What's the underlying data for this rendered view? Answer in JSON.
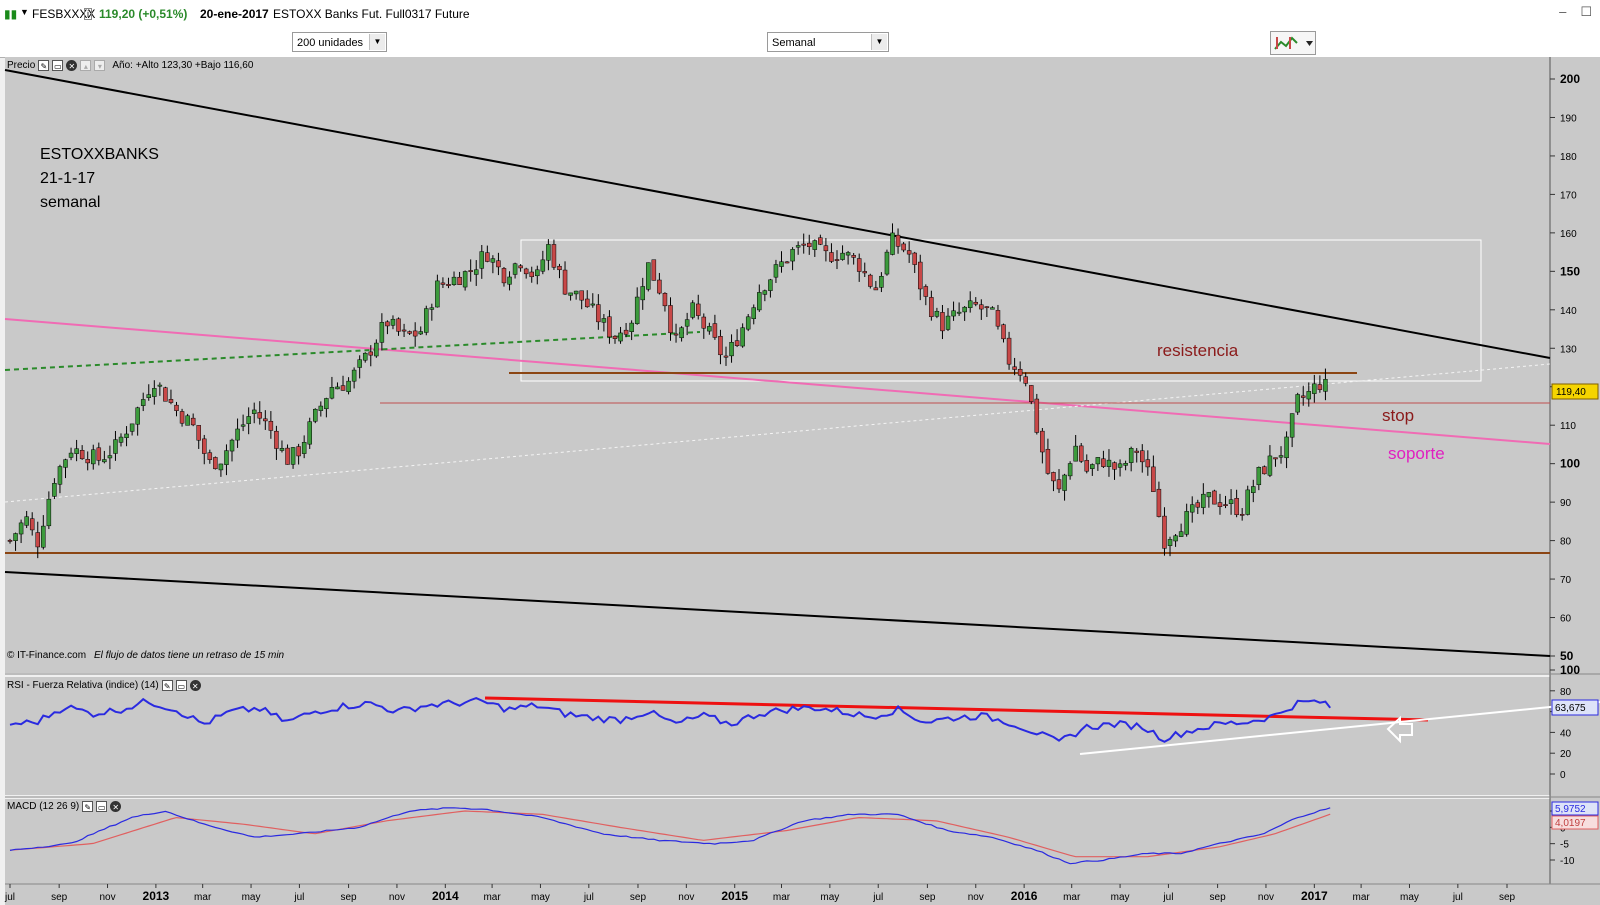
{
  "window": {
    "symbol": "FESBXXXX",
    "price_change": "119,20 (+0,51%)",
    "date": "20-ene-2017",
    "instrument": "ESTOXX Banks Fut. Full0317 Future"
  },
  "toolbar": {
    "units_select": "200 unidades",
    "period_select": "Semanal"
  },
  "price_panel": {
    "label": "Precio",
    "stats": "Año: +Alto 123,30 +Bajo 116,60",
    "last_price": "119,40",
    "footer": "© IT-Finance.com",
    "footer_note": "El flujo de datos tiene un retraso de 15 min",
    "annotation_lines": [
      "ESTOXXBANKS",
      "21-1-17",
      "semanal"
    ],
    "label_resistencia": "resistencia",
    "label_stop": "stop",
    "label_soporte": "soporte"
  },
  "rsi_panel": {
    "label": "RSI - Fuerza Relativa (indice) (14)",
    "last_value": "63,675"
  },
  "macd_panel": {
    "label": "MACD (12 26 9)",
    "last_macd": "5,9752",
    "last_signal": "4,0197"
  },
  "x_axis_labels": [
    {
      "label": "jul",
      "major": false
    },
    {
      "label": "sep",
      "major": false
    },
    {
      "label": "nov",
      "major": false
    },
    {
      "label": "2013",
      "major": true
    },
    {
      "label": "mar",
      "major": false
    },
    {
      "label": "may",
      "major": false
    },
    {
      "label": "jul",
      "major": false
    },
    {
      "label": "sep",
      "major": false
    },
    {
      "label": "nov",
      "major": false
    },
    {
      "label": "2014",
      "major": true
    },
    {
      "label": "mar",
      "major": false
    },
    {
      "label": "may",
      "major": false
    },
    {
      "label": "jul",
      "major": false
    },
    {
      "label": "sep",
      "major": false
    },
    {
      "label": "nov",
      "major": false
    },
    {
      "label": "2015",
      "major": true
    },
    {
      "label": "mar",
      "major": false
    },
    {
      "label": "may",
      "major": false
    },
    {
      "label": "jul",
      "major": false
    },
    {
      "label": "sep",
      "major": false
    },
    {
      "label": "nov",
      "major": false
    },
    {
      "label": "2016",
      "major": true
    },
    {
      "label": "mar",
      "major": false
    },
    {
      "label": "may",
      "major": false
    },
    {
      "label": "jul",
      "major": false
    },
    {
      "label": "sep",
      "major": false
    },
    {
      "label": "nov",
      "major": false
    },
    {
      "label": "2017",
      "major": true
    },
    {
      "label": "mar",
      "major": false
    },
    {
      "label": "may",
      "major": false
    },
    {
      "label": "jul",
      "major": false
    },
    {
      "label": "sep",
      "major": false
    }
  ],
  "chart_data": [
    {
      "type": "line",
      "title": "ESTOXXBANKS",
      "subtitle": "21-1-17 semanal",
      "x_range": [
        "2012-07-01",
        "2017-09-30"
      ],
      "ylim": [
        50,
        205
      ],
      "y_ticks": [
        200,
        190,
        180,
        170,
        160,
        150,
        140,
        130,
        120,
        110,
        100,
        90,
        80,
        70,
        60,
        50
      ],
      "y_tick_labels": [
        "200",
        "190",
        "180",
        "170",
        "160",
        "150",
        "140",
        "130",
        "",
        "110",
        "100",
        "90",
        "80",
        "70",
        "60",
        "50"
      ],
      "grid": false,
      "series": [
        {
          "values": [
            [
              "2012-07-01",
              80
            ],
            [
              "2012-07-21",
              86
            ],
            [
              "2012-08-04",
              79
            ],
            [
              "2012-08-25",
              96
            ],
            [
              "2012-09-15",
              104
            ],
            [
              "2012-09-29",
              103
            ],
            [
              "2012-10-20",
              101
            ],
            [
              "2012-11-10",
              104
            ],
            [
              "2012-12-01",
              111
            ],
            [
              "2012-12-29",
              122
            ],
            [
              "2013-01-26",
              114
            ],
            [
              "2013-02-16",
              110
            ],
            [
              "2013-03-09",
              100
            ],
            [
              "2013-03-23",
              101
            ],
            [
              "2013-04-13",
              108
            ],
            [
              "2013-05-04",
              114
            ],
            [
              "2013-05-25",
              109
            ],
            [
              "2013-06-15",
              101
            ],
            [
              "2013-06-29",
              103
            ],
            [
              "2013-07-20",
              112
            ],
            [
              "2013-08-10",
              120
            ],
            [
              "2013-08-31",
              121
            ],
            [
              "2013-09-21",
              127
            ],
            [
              "2013-10-19",
              137
            ],
            [
              "2013-11-09",
              133
            ],
            [
              "2013-11-30",
              134
            ],
            [
              "2013-12-21",
              146
            ],
            [
              "2014-01-11",
              148
            ],
            [
              "2014-02-01",
              150
            ],
            [
              "2014-02-22",
              155
            ],
            [
              "2014-03-15",
              149
            ],
            [
              "2014-04-05",
              153
            ],
            [
              "2014-04-26",
              148
            ],
            [
              "2014-05-10",
              157
            ],
            [
              "2014-05-31",
              146
            ],
            [
              "2014-06-21",
              143
            ],
            [
              "2014-07-12",
              138
            ],
            [
              "2014-08-02",
              133
            ],
            [
              "2014-08-23",
              137
            ],
            [
              "2014-09-13",
              152
            ],
            [
              "2014-10-04",
              143
            ],
            [
              "2014-10-18",
              131
            ],
            [
              "2014-11-08",
              140
            ],
            [
              "2014-11-29",
              134
            ],
            [
              "2014-12-20",
              127
            ],
            [
              "2015-01-10",
              135
            ],
            [
              "2015-01-31",
              145
            ],
            [
              "2015-02-21",
              150
            ],
            [
              "2015-03-14",
              155
            ],
            [
              "2015-04-04",
              157
            ],
            [
              "2015-04-25",
              154
            ],
            [
              "2015-05-16",
              155
            ],
            [
              "2015-06-06",
              152
            ],
            [
              "2015-06-27",
              145
            ],
            [
              "2015-07-18",
              158
            ],
            [
              "2015-08-08",
              155
            ],
            [
              "2015-08-29",
              143
            ],
            [
              "2015-09-19",
              136
            ],
            [
              "2015-10-10",
              139
            ],
            [
              "2015-10-31",
              141
            ],
            [
              "2015-11-21",
              139
            ],
            [
              "2015-12-12",
              127
            ],
            [
              "2016-01-02",
              123
            ],
            [
              "2016-01-16",
              110
            ],
            [
              "2016-01-30",
              98
            ],
            [
              "2016-02-13",
              92
            ],
            [
              "2016-03-05",
              105
            ],
            [
              "2016-03-19",
              98
            ],
            [
              "2016-04-09",
              101
            ],
            [
              "2016-04-30",
              98
            ],
            [
              "2016-05-21",
              104
            ],
            [
              "2016-06-11",
              95
            ],
            [
              "2016-06-25",
              80
            ],
            [
              "2016-07-09",
              83
            ],
            [
              "2016-07-30",
              87
            ],
            [
              "2016-08-20",
              91
            ],
            [
              "2016-09-10",
              90
            ],
            [
              "2016-10-01",
              88
            ],
            [
              "2016-10-22",
              97
            ],
            [
              "2016-11-12",
              102
            ],
            [
              "2016-11-26",
              104
            ],
            [
              "2016-12-10",
              116
            ],
            [
              "2016-12-24",
              118
            ],
            [
              "2017-01-07",
              121
            ],
            [
              "2017-01-21",
              119.4
            ]
          ]
        }
      ]
    },
    {
      "type": "line",
      "ylim": [
        0,
        100
      ],
      "y_ticks": [
        100,
        80,
        60,
        40,
        20,
        0
      ],
      "y_tick_labels": [
        "100",
        "80",
        "",
        "40",
        "20",
        "0"
      ],
      "grid": false,
      "series": [
        {
          "values": [
            [
              "2012-07-01",
              48
            ],
            [
              "2012-08-04",
              50
            ],
            [
              "2012-09-08",
              65
            ],
            [
              "2012-10-13",
              58
            ],
            [
              "2012-11-17",
              62
            ],
            [
              "2012-12-22",
              70
            ],
            [
              "2013-01-26",
              62
            ],
            [
              "2013-03-02",
              48
            ],
            [
              "2013-04-06",
              60
            ],
            [
              "2013-05-11",
              63
            ],
            [
              "2013-06-15",
              50
            ],
            [
              "2013-07-20",
              60
            ],
            [
              "2013-08-24",
              65
            ],
            [
              "2013-09-28",
              68
            ],
            [
              "2013-11-02",
              60
            ],
            [
              "2013-12-07",
              66
            ],
            [
              "2014-01-11",
              68
            ],
            [
              "2014-02-15",
              70
            ],
            [
              "2014-03-22",
              62
            ],
            [
              "2014-04-26",
              66
            ],
            [
              "2014-05-31",
              58
            ],
            [
              "2014-07-05",
              54
            ],
            [
              "2014-08-09",
              52
            ],
            [
              "2014-09-13",
              60
            ],
            [
              "2014-10-18",
              48
            ],
            [
              "2014-11-22",
              56
            ],
            [
              "2014-12-27",
              48
            ],
            [
              "2015-01-31",
              58
            ],
            [
              "2015-03-07",
              62
            ],
            [
              "2015-04-11",
              64
            ],
            [
              "2015-05-16",
              60
            ],
            [
              "2015-06-20",
              55
            ],
            [
              "2015-07-25",
              62
            ],
            [
              "2015-08-29",
              50
            ],
            [
              "2015-10-03",
              54
            ],
            [
              "2015-11-07",
              56
            ],
            [
              "2015-12-12",
              50
            ],
            [
              "2016-01-16",
              40
            ],
            [
              "2016-02-13",
              30
            ],
            [
              "2016-03-19",
              45
            ],
            [
              "2016-04-23",
              48
            ],
            [
              "2016-05-28",
              46
            ],
            [
              "2016-06-25",
              34
            ],
            [
              "2016-07-30",
              42
            ],
            [
              "2016-09-03",
              48
            ],
            [
              "2016-10-08",
              50
            ],
            [
              "2016-11-12",
              56
            ],
            [
              "2016-12-10",
              68
            ],
            [
              "2017-01-07",
              70
            ],
            [
              "2017-01-21",
              63.675
            ]
          ]
        }
      ]
    },
    {
      "type": "line",
      "ylim": [
        -15,
        10
      ],
      "y_ticks": [
        5,
        0,
        -5,
        -10
      ],
      "y_tick_labels": [
        "",
        "0",
        "-5",
        "-10"
      ],
      "grid": false,
      "series": [
        {
          "values": [
            [
              "2012-07-01",
              -7
            ],
            [
              "2012-09-15",
              -5
            ],
            [
              "2012-12-01",
              3
            ],
            [
              "2013-01-12",
              5
            ],
            [
              "2013-03-02",
              1
            ],
            [
              "2013-05-04",
              -3
            ],
            [
              "2013-06-29",
              -2
            ],
            [
              "2013-09-14",
              0
            ],
            [
              "2013-11-16",
              5
            ],
            [
              "2014-01-11",
              6
            ],
            [
              "2014-02-22",
              5.5
            ],
            [
              "2014-05-03",
              3
            ],
            [
              "2014-07-19",
              -2
            ],
            [
              "2014-09-27",
              -4
            ],
            [
              "2014-12-06",
              -5
            ],
            [
              "2015-01-24",
              -4
            ],
            [
              "2015-03-28",
              2
            ],
            [
              "2015-05-30",
              4
            ],
            [
              "2015-07-25",
              4
            ],
            [
              "2015-09-26",
              -1
            ],
            [
              "2015-11-21",
              -3
            ],
            [
              "2016-01-16",
              -7
            ],
            [
              "2016-02-27",
              -11
            ],
            [
              "2016-04-09",
              -10
            ],
            [
              "2016-06-04",
              -8
            ],
            [
              "2016-07-16",
              -8
            ],
            [
              "2016-09-03",
              -5
            ],
            [
              "2016-10-29",
              -2
            ],
            [
              "2016-12-10",
              3
            ],
            [
              "2017-01-21",
              5.9752
            ]
          ]
        },
        {
          "values": [
            [
              "2012-07-01",
              -7
            ],
            [
              "2012-10-13",
              -5
            ],
            [
              "2013-01-26",
              3
            ],
            [
              "2013-04-20",
              1
            ],
            [
              "2013-07-20",
              -2
            ],
            [
              "2013-10-19",
              2
            ],
            [
              "2014-01-25",
              5
            ],
            [
              "2014-05-03",
              4
            ],
            [
              "2014-08-09",
              0
            ],
            [
              "2014-11-22",
              -4
            ],
            [
              "2015-03-07",
              -1
            ],
            [
              "2015-06-06",
              3
            ],
            [
              "2015-09-12",
              2
            ],
            [
              "2015-12-12",
              -3
            ],
            [
              "2016-03-05",
              -9
            ],
            [
              "2016-06-04",
              -9
            ],
            [
              "2016-09-03",
              -6
            ],
            [
              "2016-11-12",
              -2
            ],
            [
              "2017-01-21",
              4.0197
            ]
          ]
        }
      ]
    }
  ],
  "colors": {
    "chart_bg": "#c9c9c9",
    "candle_up": "#3c9a3c",
    "candle_down": "#c84848",
    "trendline": "#000000",
    "support_line_pink": "#f06bb4",
    "horizontal_brown": "#8b4513",
    "stop_line": "#c05050",
    "green_dashed": "#2a8a2a",
    "rsi_line": "#2a2ae0",
    "rsi_red_trend": "#ee1111",
    "macd_line": "#2a2ae0",
    "signal_line": "#e06060",
    "resistencia_text": "#8b1a1a",
    "soporte_text": "#e020c0"
  }
}
